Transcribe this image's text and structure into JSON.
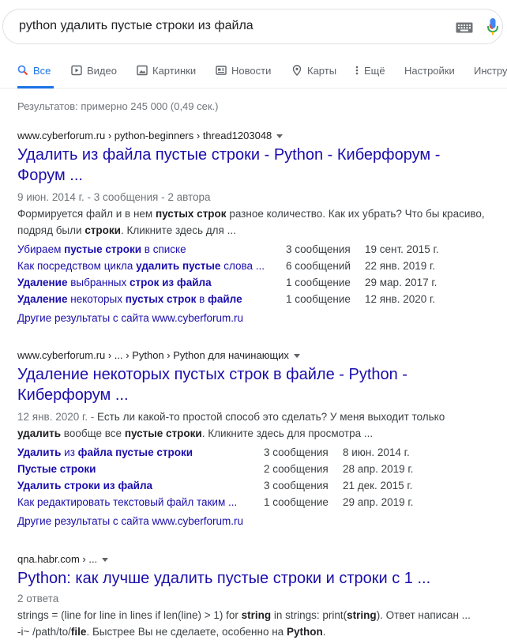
{
  "search": {
    "query": "python удалить пустые строки из файла"
  },
  "tabs": [
    {
      "label": "Все",
      "icon": "search-icon"
    },
    {
      "label": "Видео",
      "icon": "video-icon"
    },
    {
      "label": "Картинки",
      "icon": "image-icon"
    },
    {
      "label": "Новости",
      "icon": "news-icon"
    },
    {
      "label": "Карты",
      "icon": "map-pin-icon"
    },
    {
      "label": "Ещё",
      "icon": "more-vert-icon"
    },
    {
      "label": "Настройки"
    },
    {
      "label": "Инстру"
    }
  ],
  "stats": "Результатов: примерно 245 000 (0,49 сек.)",
  "results": [
    {
      "crumb": "www.cyberforum.ru › python-beginners › thread1203048",
      "title_line1": "Удалить из файла пустые строки - Python - Киберфорум -",
      "title_line2": "Форум ...",
      "date": "9 июн. 2014 г. - 3 сообщения - 2 автора",
      "snippet_parts": [
        "Формируется файл и в нем ",
        "пустых строк",
        " разное количество. Как их убрать? Что бы красиво, подряд были ",
        "строки",
        ". Кликните здесь для ..."
      ],
      "sitelinks": [
        {
          "parts": [
            "Убираем ",
            "пустые строки",
            " в списке"
          ],
          "count": "3 сообщения",
          "date": "19 сент. 2015 г."
        },
        {
          "parts": [
            "Как посредством цикла ",
            "удалить пустые",
            " слова ..."
          ],
          "count": "6 сообщений",
          "date": "22 янв. 2019 г."
        },
        {
          "parts": [
            "Удаление",
            " выбранных ",
            "строк из файла"
          ],
          "count": "1 сообщение",
          "date": "29 мар. 2017 г."
        },
        {
          "parts": [
            "Удаление",
            " некоторых ",
            "пустых строк",
            " в ",
            "файле"
          ],
          "count": "1 сообщение",
          "date": "12 янв. 2020 г."
        }
      ],
      "more": "Другие результаты с сайта www.cyberforum.ru"
    },
    {
      "crumb": "www.cyberforum.ru › ... › Python › Python для начинающих",
      "title_line1": "Удаление некоторых пустых строк в файле - Python -",
      "title_line2": "Киберфорум ...",
      "date": "12 янв. 2020 г. -",
      "snippet_parts": [
        " Есть ли какой-то простой способ это сделать? У меня выходит только ",
        "удалить",
        " вообще все ",
        "пустые строки",
        ". Кликните здесь для просмотра ..."
      ],
      "sitelinks": [
        {
          "parts": [
            "Удалить",
            " из ",
            "файла пустые строки"
          ],
          "count": "3 сообщения",
          "date": "8 июн. 2014 г."
        },
        {
          "parts": [
            "Пустые строки"
          ],
          "count": "2 сообщения",
          "date": "28 апр. 2019 г."
        },
        {
          "parts": [
            "Удалить строки из файла"
          ],
          "count": "3 сообщения",
          "date": "21 дек. 2015 г."
        },
        {
          "parts": [
            "Как редактировать текстовый файл таким ..."
          ],
          "count": "1 сообщение",
          "date": "29 апр. 2019 г."
        }
      ],
      "more": "Другие результаты с сайта www.cyberforum.ru"
    },
    {
      "crumb": "qna.habr.com › ...",
      "title_line1": "Python: как лучше удалить пустые строки и строки с 1 ...",
      "date": "2 ответа",
      "snippet_line1": [
        "strings = (line for line in lines if len(line) > 1) for ",
        "string",
        " in strings: print(",
        "string",
        "). Ответ написан ..."
      ],
      "snippet_line2": [
        "-i~ /path/to/",
        "file",
        ". Быстрее Вы не сделаете, особенно на ",
        "Python",
        "."
      ]
    }
  ],
  "colors": {
    "link": "#1a0dab",
    "accent": "#1a73e8",
    "muted": "#70757a"
  }
}
